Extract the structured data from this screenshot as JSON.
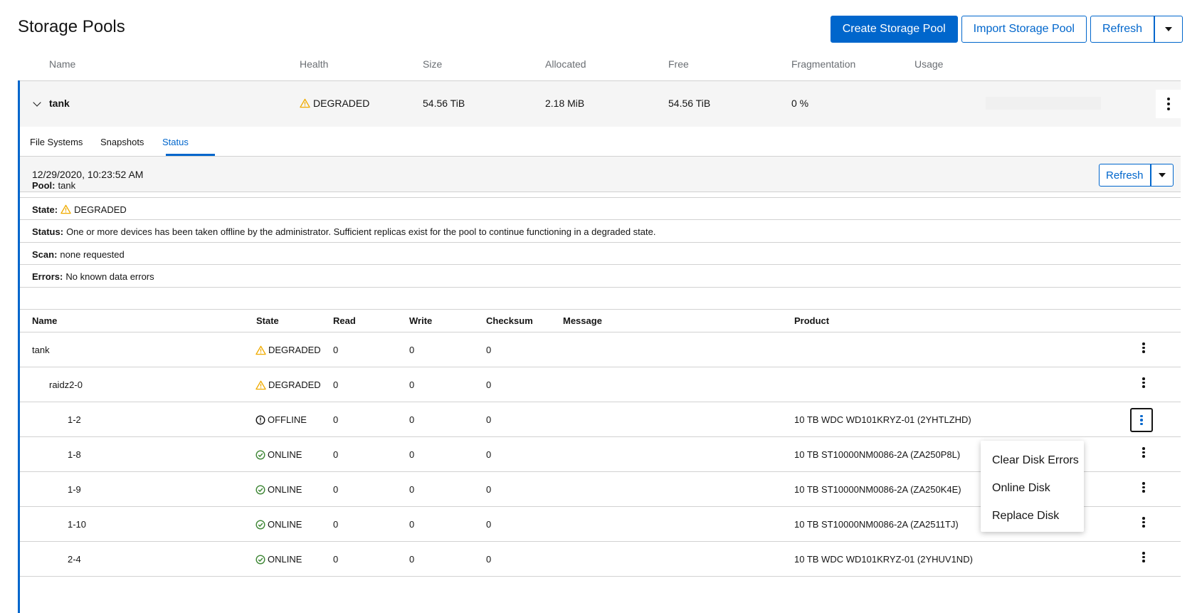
{
  "page": {
    "title": "Storage Pools"
  },
  "toolbar": {
    "create_label": "Create Storage Pool",
    "import_label": "Import Storage Pool",
    "refresh_label": "Refresh"
  },
  "pool_columns": [
    "Name",
    "Health",
    "Size",
    "Allocated",
    "Free",
    "Fragmentation",
    "Usage"
  ],
  "pool": {
    "name": "tank",
    "health": "DEGRADED",
    "size": "54.56 TiB",
    "allocated": "2.18 MiB",
    "free": "54.56 TiB",
    "fragmentation": "0 %",
    "usage_fraction": 0.0
  },
  "tabs": [
    "File Systems",
    "Snapshots",
    "Status"
  ],
  "active_tab": "Status",
  "status": {
    "timestamp": "12/29/2020, 10:23:52 AM",
    "refresh_label": "Refresh",
    "pool_label": "Pool:",
    "pool_value": "tank",
    "state_label": "State:",
    "state_value": "DEGRADED",
    "status_label": "Status:",
    "status_value": "One or more devices has been taken offline by the administrator. Sufficient replicas exist for the pool to continue functioning in a degraded state.",
    "scan_label": "Scan:",
    "scan_value": "none requested",
    "errors_label": "Errors:",
    "errors_value": "No known data errors"
  },
  "device_columns": [
    "Name",
    "State",
    "Read",
    "Write",
    "Checksum",
    "Message",
    "Product"
  ],
  "devices": [
    {
      "name": "tank",
      "state": "DEGRADED",
      "state_icon": "warning-icon",
      "read": "0",
      "write": "0",
      "checksum": "0",
      "message": "",
      "product": ""
    },
    {
      "name": "raidz2-0",
      "state": "DEGRADED",
      "state_icon": "warning-icon",
      "read": "0",
      "write": "0",
      "checksum": "0",
      "message": "",
      "product": ""
    },
    {
      "name": "1-2",
      "state": "OFFLINE",
      "state_icon": "info-icon",
      "read": "0",
      "write": "0",
      "checksum": "0",
      "message": "",
      "product": "10 TB WDC WD101KRYZ-01 (2YHTLZHD)"
    },
    {
      "name": "1-8",
      "state": "ONLINE",
      "state_icon": "check-circle-icon",
      "read": "0",
      "write": "0",
      "checksum": "0",
      "message": "",
      "product": "10 TB ST10000NM0086-2A (ZA250P8L)"
    },
    {
      "name": "1-9",
      "state": "ONLINE",
      "state_icon": "check-circle-icon",
      "read": "0",
      "write": "0",
      "checksum": "0",
      "message": "",
      "product": "10 TB ST10000NM0086-2A (ZA250K4E)"
    },
    {
      "name": "1-10",
      "state": "ONLINE",
      "state_icon": "check-circle-icon",
      "read": "0",
      "write": "0",
      "checksum": "0",
      "message": "",
      "product": "10 TB ST10000NM0086-2A (ZA2511TJ)"
    },
    {
      "name": "2-4",
      "state": "ONLINE",
      "state_icon": "check-circle-icon",
      "read": "0",
      "write": "0",
      "checksum": "0",
      "message": "",
      "product": "10 TB WDC WD101KRYZ-01 (2YHUV1ND)"
    }
  ],
  "context_menu": [
    "Clear Disk Errors",
    "Online Disk",
    "Replace Disk"
  ],
  "colors": {
    "accent": "#0066cc",
    "warning": "#f0ab00",
    "success": "#3e8635"
  }
}
